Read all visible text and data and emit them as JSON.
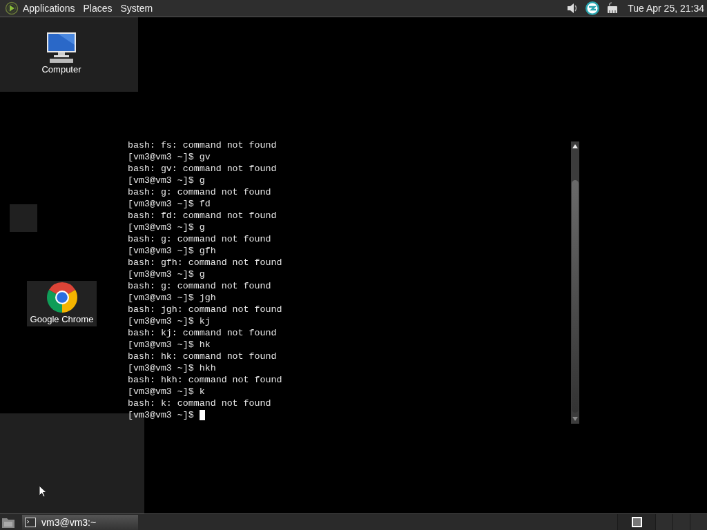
{
  "top_panel": {
    "menus": [
      "Applications",
      "Places",
      "System"
    ],
    "clock": "Tue Apr 25, 21:34"
  },
  "desktop_icons": [
    {
      "label": "Computer",
      "kind": "computer"
    },
    {
      "label": "Google Chrome",
      "kind": "browser"
    }
  ],
  "terminal": {
    "lines": [
      "bash: fs: command not found",
      "[vm3@vm3 ~]$ gv",
      "bash: gv: command not found",
      "[vm3@vm3 ~]$ g",
      "bash: g: command not found",
      "[vm3@vm3 ~]$ fd",
      "bash: fd: command not found",
      "[vm3@vm3 ~]$ g",
      "bash: g: command not found",
      "[vm3@vm3 ~]$ gfh",
      "bash: gfh: command not found",
      "[vm3@vm3 ~]$ g",
      "bash: g: command not found",
      "[vm3@vm3 ~]$ jgh",
      "bash: jgh: command not found",
      "[vm3@vm3 ~]$ kj",
      "bash: kj: command not found",
      "[vm3@vm3 ~]$ hk",
      "bash: hk: command not found",
      "[vm3@vm3 ~]$ hkh",
      "bash: hkh: command not found",
      "[vm3@vm3 ~]$ k",
      "bash: k: command not found"
    ],
    "prompt": "[vm3@vm3 ~]$"
  },
  "taskbar": {
    "tasks": [
      {
        "label": "vm3@vm3:~",
        "selected": true
      }
    ]
  }
}
